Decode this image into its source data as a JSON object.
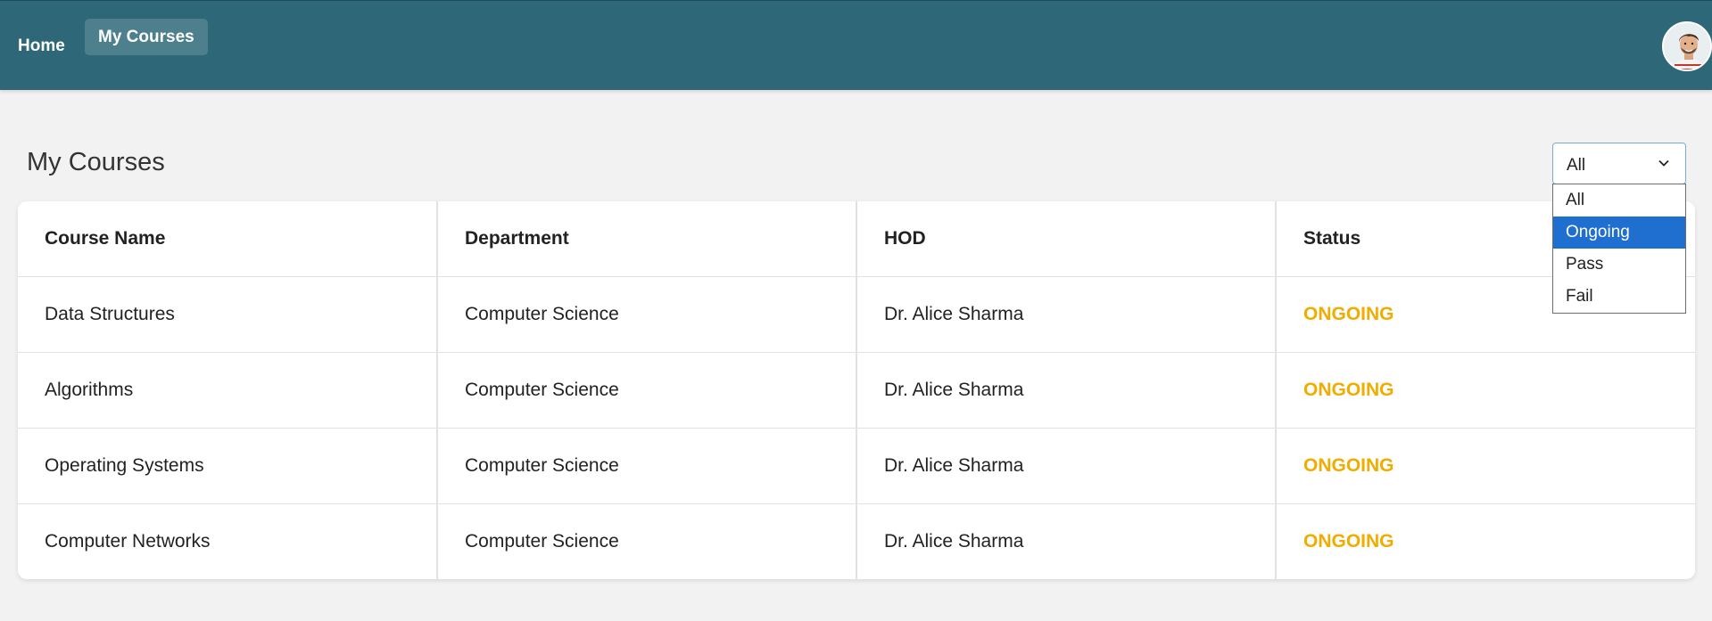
{
  "nav": {
    "home_label": "Home",
    "my_courses_label": "My Courses"
  },
  "page": {
    "title": "My Courses"
  },
  "filter": {
    "selected_value": "All",
    "options": [
      "All",
      "Ongoing",
      "Pass",
      "Fail"
    ],
    "highlighted_option": "Ongoing"
  },
  "table": {
    "headers": [
      "Course Name",
      "Department",
      "HOD",
      "Status"
    ],
    "rows": [
      {
        "course": "Data Structures",
        "department": "Computer Science",
        "hod": "Dr. Alice Sharma",
        "status": "ONGOING"
      },
      {
        "course": "Algorithms",
        "department": "Computer Science",
        "hod": "Dr. Alice Sharma",
        "status": "ONGOING"
      },
      {
        "course": "Operating Systems",
        "department": "Computer Science",
        "hod": "Dr. Alice Sharma",
        "status": "ONGOING"
      },
      {
        "course": "Computer Networks",
        "department": "Computer Science",
        "hod": "Dr. Alice Sharma",
        "status": "ONGOING"
      }
    ]
  },
  "colors": {
    "nav_background": "#2e6878",
    "nav_active_background": "#4d7f8c",
    "status_ongoing": "#f0ad00",
    "dropdown_highlight": "#1f6fd1",
    "page_background": "#f2f2f2"
  },
  "icons": {
    "filter_chevron": "chevron-down-icon",
    "avatar": "user-avatar-icon"
  }
}
